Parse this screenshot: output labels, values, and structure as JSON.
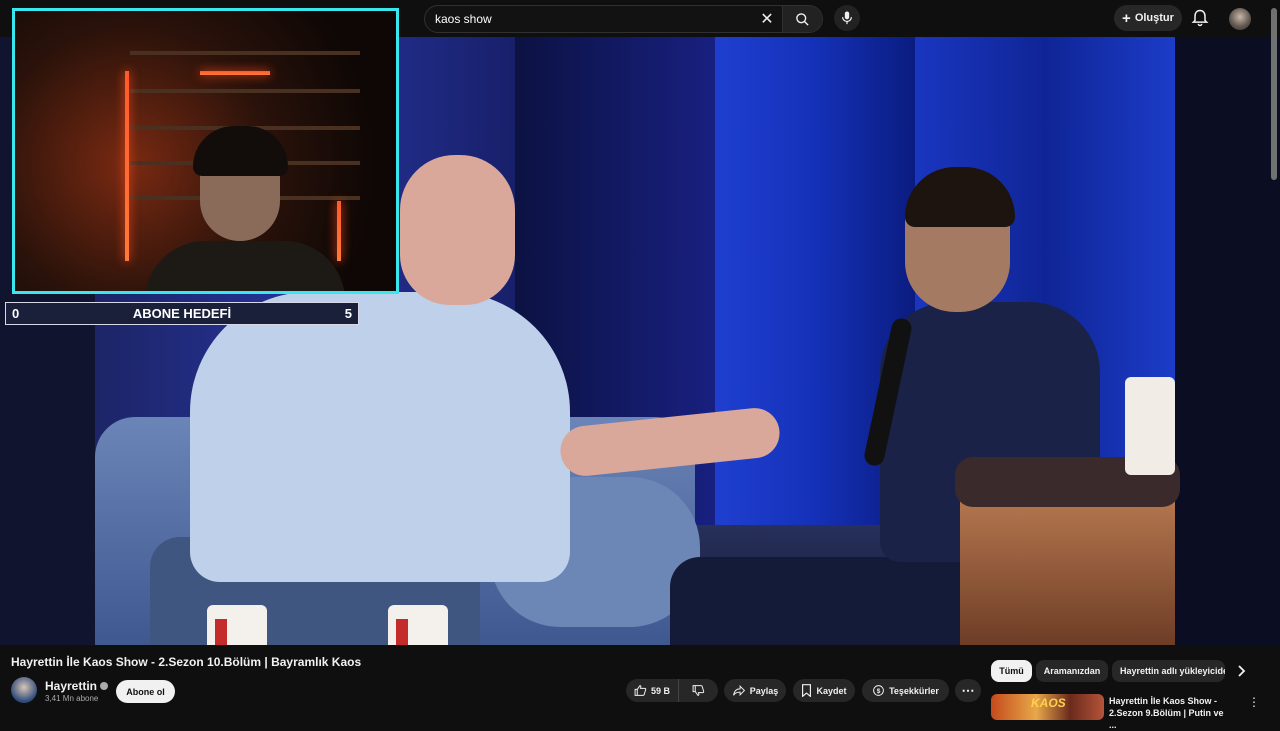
{
  "search": {
    "query": "kaos show"
  },
  "header": {
    "create_label": "Oluştur"
  },
  "overlay": {
    "goal_label": "ABONE HEDEFİ",
    "goal_current": "0",
    "goal_target": "5",
    "goal_progress": 0
  },
  "video": {
    "title": "Hayrettin İle Kaos Show - 2.Sezon 10.Bölüm | Bayramlık Kaos",
    "channel": "Hayrettin",
    "subscribers": "3,41 Mn abone",
    "subscribe_label": "Abone ol",
    "likes": "59 B",
    "share_label": "Paylaş",
    "save_label": "Kaydet",
    "thanks_label": "Teşekkürler"
  },
  "chips": [
    "Tümü",
    "Aramanızdan",
    "Hayrettin adlı yükleyiciden"
  ],
  "recommendation": {
    "title": "Hayrettin İle Kaos Show - 2.Sezon 9.Bölüm | Putin ve ...",
    "thumb_text": "KAOS"
  },
  "colors": {
    "accent_cyan": "#39e7ef",
    "background": "#0f0f0f",
    "pill": "#272727"
  }
}
